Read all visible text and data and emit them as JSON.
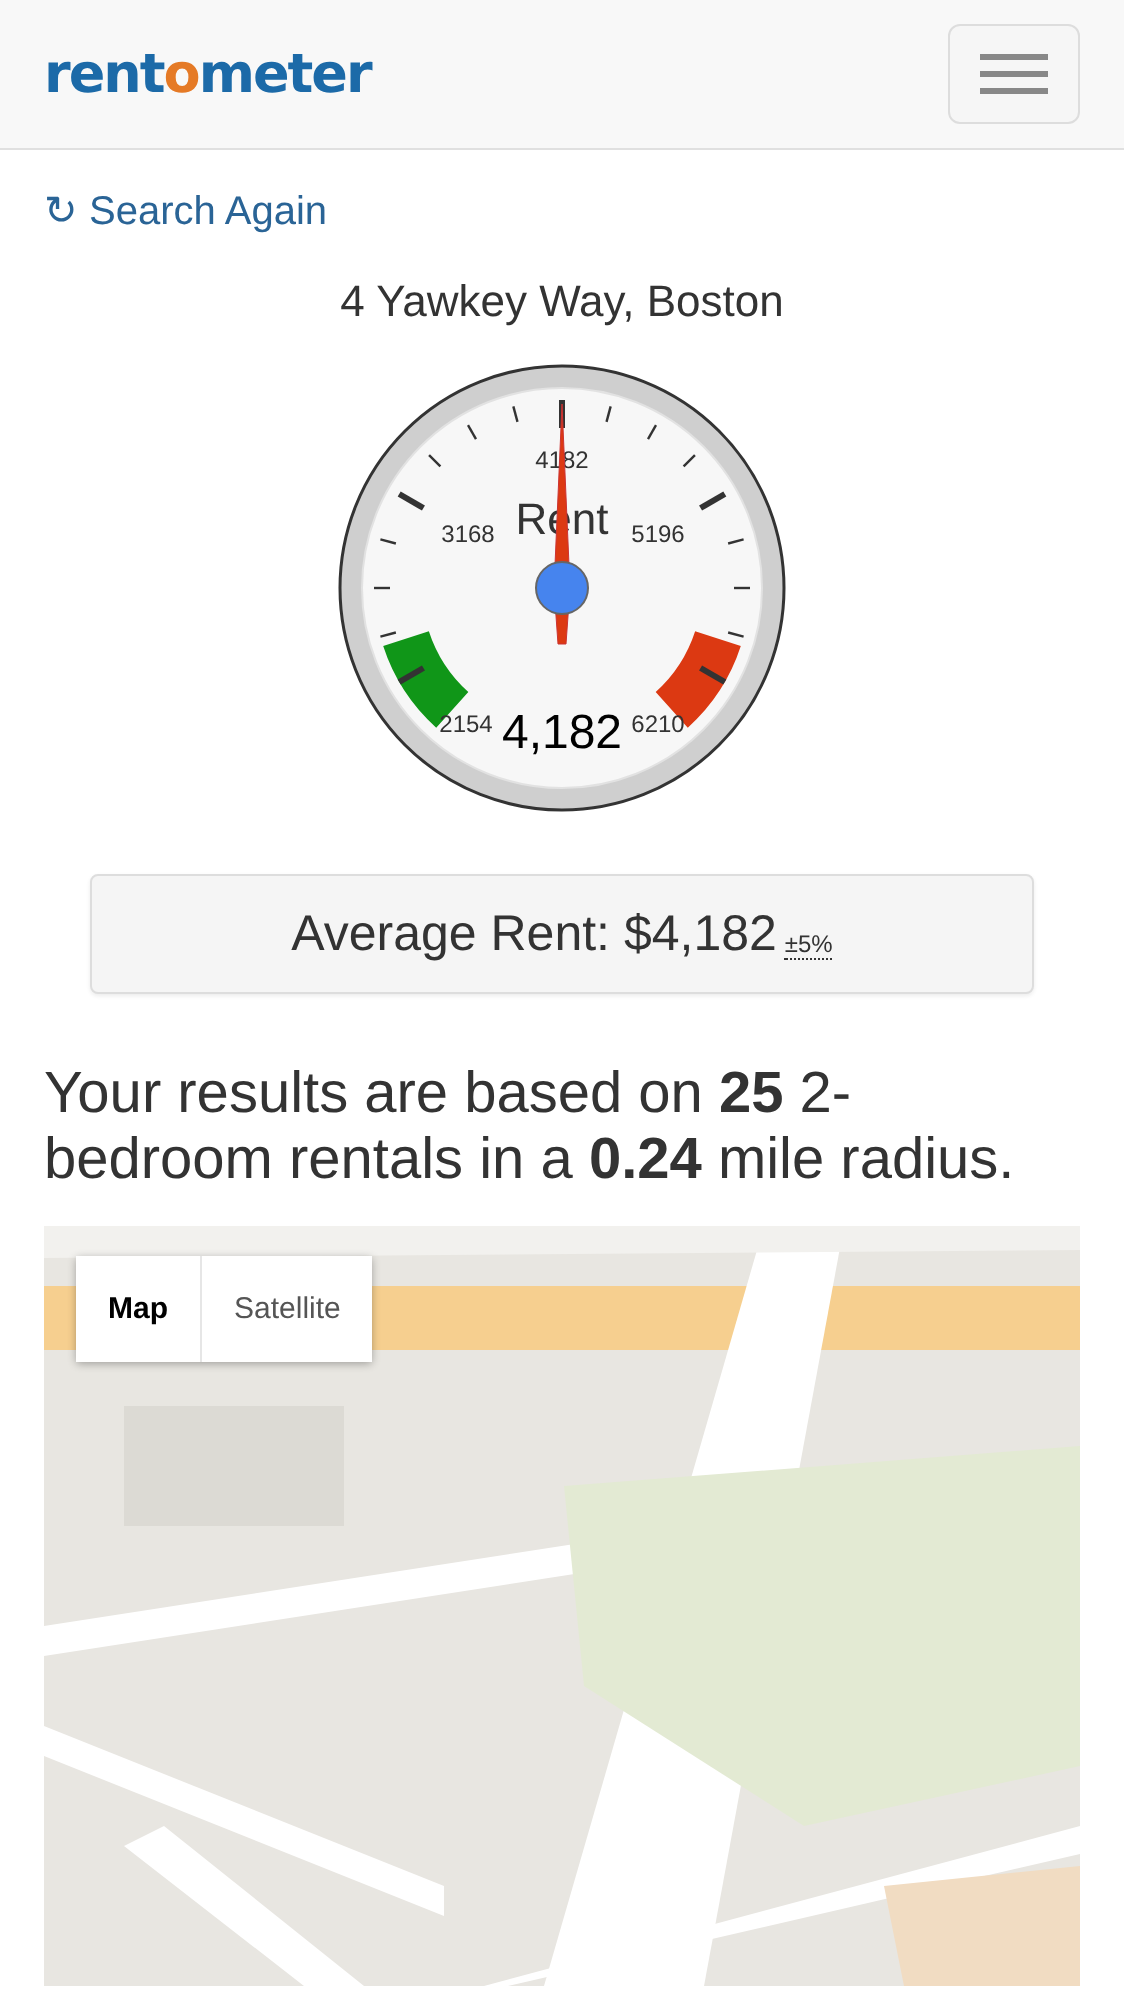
{
  "header": {
    "logo": [
      {
        "text": "rent",
        "accent": false
      },
      {
        "text": "o",
        "accent": true
      },
      {
        "text": "meter",
        "accent": false
      }
    ]
  },
  "search_again": {
    "icon": "↻",
    "label": "Search Again"
  },
  "address": "4 Yawkey Way, Boston",
  "gauge": {
    "title": "Rent",
    "reading": "4,182",
    "level": 0.5,
    "ticks": [
      {
        "label": "2154"
      },
      {
        "label": "3168"
      },
      {
        "label": "4182"
      },
      {
        "label": "5196"
      },
      {
        "label": "6210"
      }
    ]
  },
  "average": {
    "label": "Average Rent: $4,182",
    "margin": "±5%"
  },
  "summary": "Your results are based on **25** 2-bedroom rentals in a **0.24** mile radius.",
  "map": {
    "modes": [
      {
        "label": "Map",
        "selected": true
      },
      {
        "label": "Satellite",
        "selected": false
      }
    ]
  }
}
